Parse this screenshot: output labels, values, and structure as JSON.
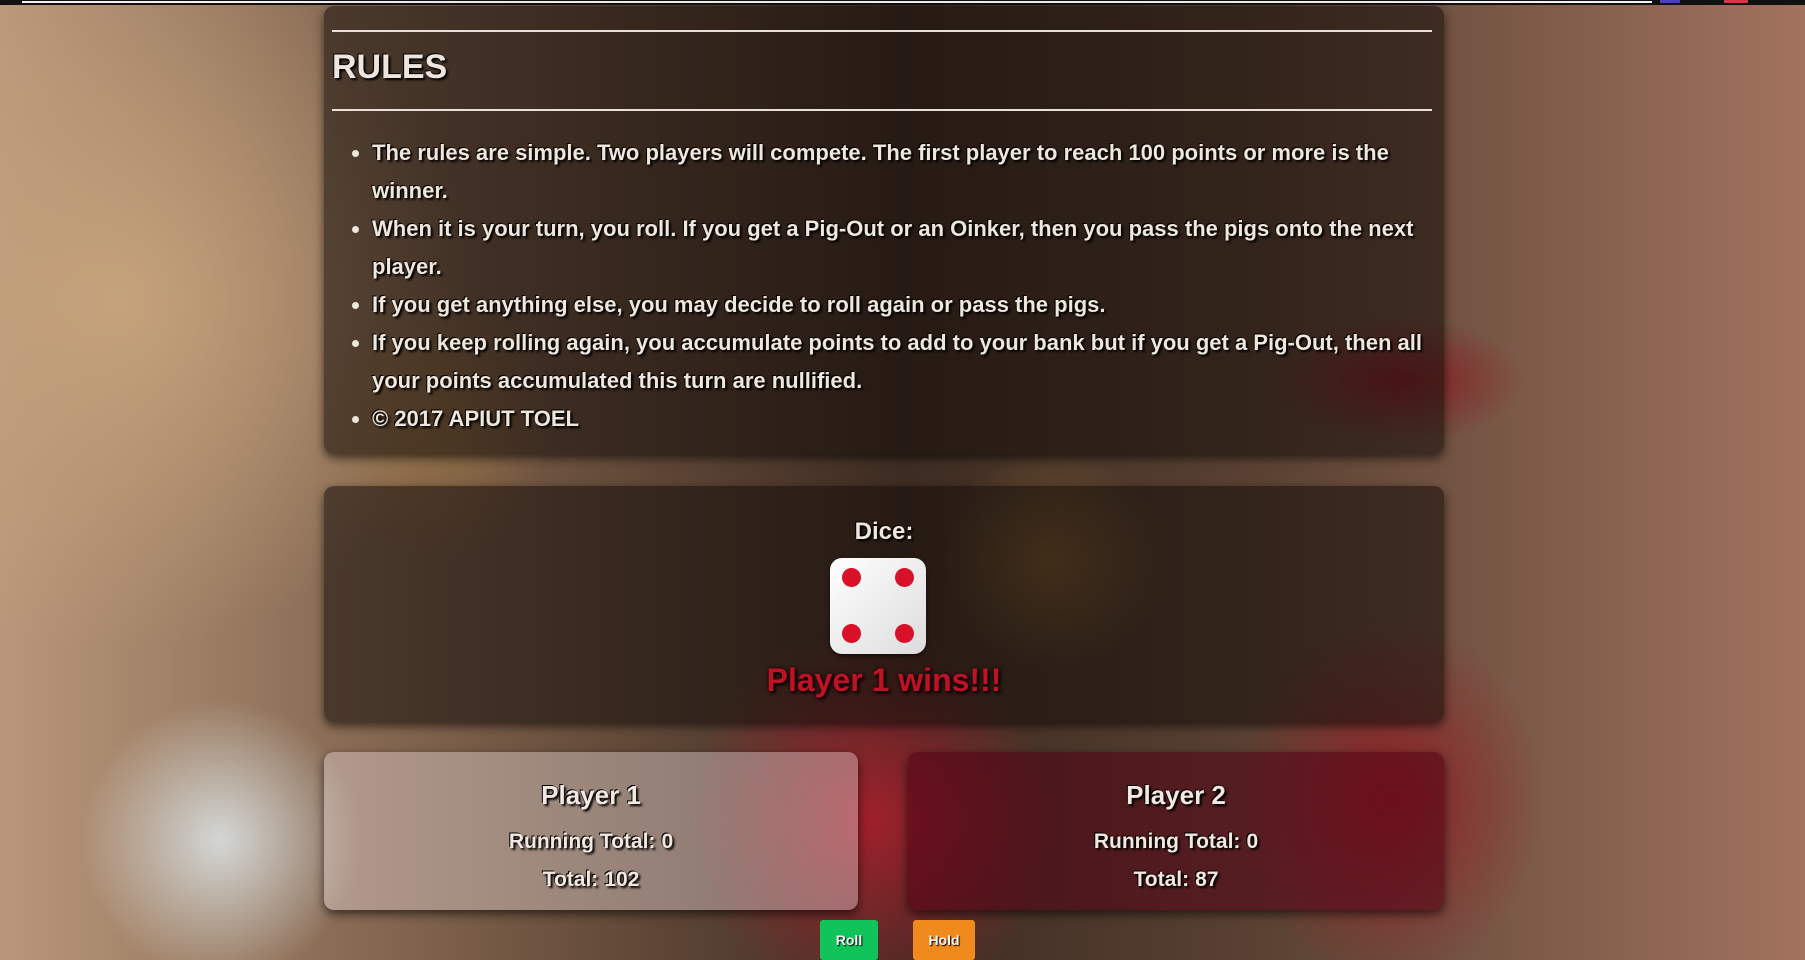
{
  "rules": {
    "heading": "RULES",
    "items": [
      "The rules are simple. Two players will compete. The first player to reach 100 points or more is the winner.",
      "When it is your turn, you roll. If you get a Pig-Out or an Oinker, then you pass the pigs onto the next player.",
      "If you get anything else, you may decide to roll again or pass the pigs.",
      "If you keep rolling again, you accumulate points to add to your bank but if you get a Pig-Out, then all your points accumulated this turn are nullified.",
      "© 2017 APIUT TOEL"
    ]
  },
  "dice": {
    "label": "Dice:",
    "face_value": 4,
    "pip_color": "#d8102a"
  },
  "status": "Player 1 wins!!!",
  "players": [
    {
      "name": "Player 1",
      "running_total_label": "Running Total:",
      "running_total": "0",
      "total_label": "Total:",
      "total": "102"
    },
    {
      "name": "Player 2",
      "running_total_label": "Running Total:",
      "running_total": "0",
      "total_label": "Total:",
      "total": "87"
    }
  ],
  "controls": {
    "roll_label": "Roll",
    "hold_label": "Hold",
    "roll_color": "#10c45a",
    "hold_color": "#f08a1c"
  }
}
